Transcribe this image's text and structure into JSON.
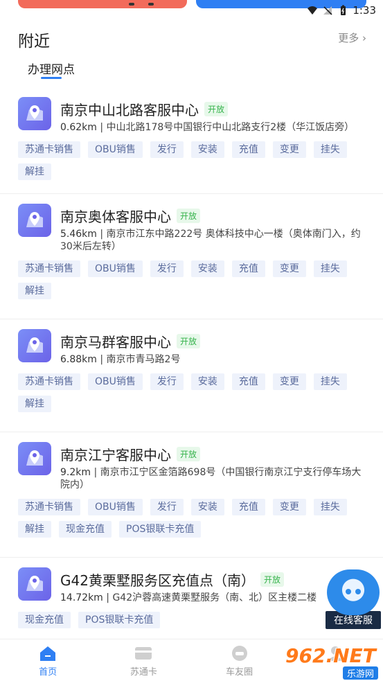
{
  "status_bar": {
    "time": "1:33"
  },
  "section": {
    "title": "附近",
    "more": "更多 ›"
  },
  "tab": {
    "label": "办理网点"
  },
  "outlets": [
    {
      "name": "南京中山北路客服中心",
      "status": "开放",
      "distance": "0.62km",
      "address": "中山北路178号中国银行中山北路支行2楼（华江饭店旁）",
      "tags": [
        "苏通卡销售",
        "OBU销售",
        "发行",
        "安装",
        "充值",
        "变更",
        "挂失",
        "解挂"
      ]
    },
    {
      "name": "南京奥体客服中心",
      "status": "开放",
      "distance": "5.46km",
      "address": "南京市江东中路222号 奥体科技中心一楼（奥体南门入，约30米后左转）",
      "tags": [
        "苏通卡销售",
        "OBU销售",
        "发行",
        "安装",
        "充值",
        "变更",
        "挂失",
        "解挂"
      ]
    },
    {
      "name": "南京马群客服中心",
      "status": "开放",
      "distance": "6.88km",
      "address": "南京市青马路2号",
      "tags": [
        "苏通卡销售",
        "OBU销售",
        "发行",
        "安装",
        "充值",
        "变更",
        "挂失",
        "解挂"
      ]
    },
    {
      "name": "南京江宁客服中心",
      "status": "开放",
      "distance": "9.2km",
      "address": "南京市江宁区金箔路698号（中国银行南京江宁支行停车场大院内）",
      "tags": [
        "苏通卡销售",
        "OBU销售",
        "发行",
        "安装",
        "充值",
        "变更",
        "挂失",
        "解挂",
        "现金充值",
        "POS银联卡充值"
      ]
    },
    {
      "name": "G42黄栗墅服务区充值点（南）",
      "status": "开放",
      "distance": "14.72km",
      "address": "G42沪蓉高速黄栗墅服务（南、北）区主楼二楼",
      "tags": [
        "现金充值",
        "POS银联卡充值"
      ]
    }
  ],
  "floating_service": {
    "label": "在线客服"
  },
  "bottom_nav": [
    {
      "label": "首页",
      "icon": "home-icon"
    },
    {
      "label": "苏通卡",
      "icon": "card-icon"
    },
    {
      "label": "车友圈",
      "icon": "car-circle-icon"
    },
    {
      "label": "",
      "icon": "profile-icon"
    }
  ],
  "watermark": {
    "top": "962.NET",
    "bottom": "乐游网"
  },
  "colors": {
    "accent": "#2f7ff3",
    "open_green": "#34b24a",
    "tag_bg": "#eef2fb"
  }
}
